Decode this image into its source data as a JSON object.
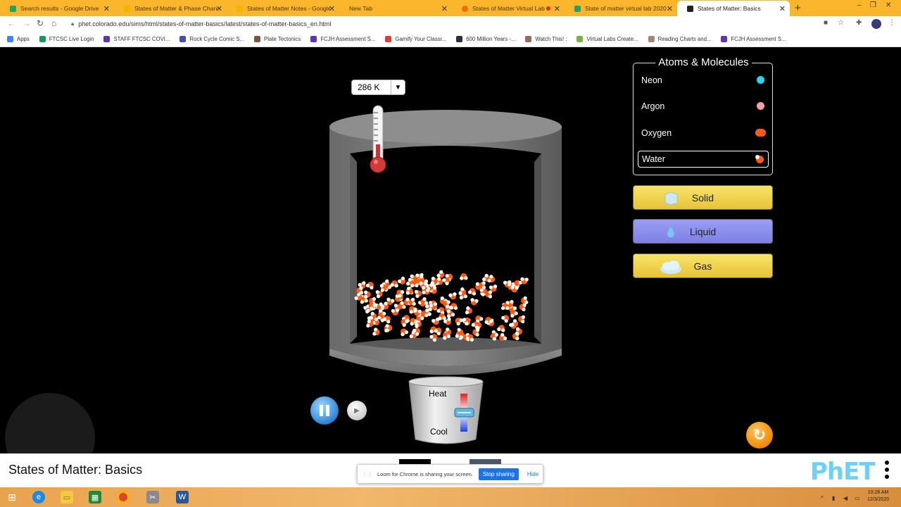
{
  "browser": {
    "tabs": [
      {
        "title": "Search results - Google Drive",
        "color": "#1fa463"
      },
      {
        "title": "States of Matter & Phase Change",
        "color": "#f4b400"
      },
      {
        "title": "States of Matter Notes - Google",
        "color": "#f4b400"
      },
      {
        "title": "New Tab",
        "color": "#fab52a"
      },
      {
        "title": "States of Matter Virtual Lab",
        "color": "#e8710a"
      },
      {
        "title": "State of matter virtual lab 2020",
        "color": "#1fa463"
      },
      {
        "title": "States of Matter: Basics",
        "color": "#222222"
      }
    ],
    "url": "phet.colorado.edu/sims/html/states-of-matter-basics/latest/states-of-matter-basics_en.html",
    "bookmarks": [
      {
        "label": "Apps",
        "color": "#4285f4"
      },
      {
        "label": "FTCSC Live Login",
        "color": "#0f9d58"
      },
      {
        "label": "STAFF FTCSC COVI...",
        "color": "#5e35b1"
      },
      {
        "label": "Rock Cycle Comic S...",
        "color": "#3f51b5"
      },
      {
        "label": "Plate Tectonics",
        "color": "#795548"
      },
      {
        "label": "FCJH Assessment S...",
        "color": "#5e35b1"
      },
      {
        "label": "Gamify Your Classr...",
        "color": "#e53935"
      },
      {
        "label": "600 Million Years -...",
        "color": "#263238"
      },
      {
        "label": "Watch This! :",
        "color": "#8d6e63"
      },
      {
        "label": "Virtual Labs Create...",
        "color": "#7cb342"
      },
      {
        "label": "Reading Charts and...",
        "color": "#a1887f"
      },
      {
        "label": "FCJH Assessment S...",
        "color": "#5e35b1"
      }
    ]
  },
  "sim": {
    "temperature": "286 K",
    "atoms_panel_title": "Atoms & Molecules",
    "atoms": [
      {
        "label": "Neon",
        "color": "#22d8e8",
        "selected": false
      },
      {
        "label": "Argon",
        "color": "#f4a0a8",
        "selected": false
      },
      {
        "label": "Oxygen",
        "color": "#ff5a10",
        "selected": false
      },
      {
        "label": "Water",
        "color": "#ff5a10",
        "selected": true
      }
    ],
    "phases": {
      "solid": "Solid",
      "liquid": "Liquid",
      "gas": "Gas"
    },
    "heat_label": "Heat",
    "cool_label": "Cool",
    "title": "States of Matter: Basics"
  },
  "loom": {
    "message": "Loom for Chrome is sharing your screen.",
    "stop": "Stop sharing",
    "hide": "Hide"
  },
  "phet_logo": "PhET",
  "clock": {
    "time": "10:28 AM",
    "date": "12/3/2020"
  }
}
